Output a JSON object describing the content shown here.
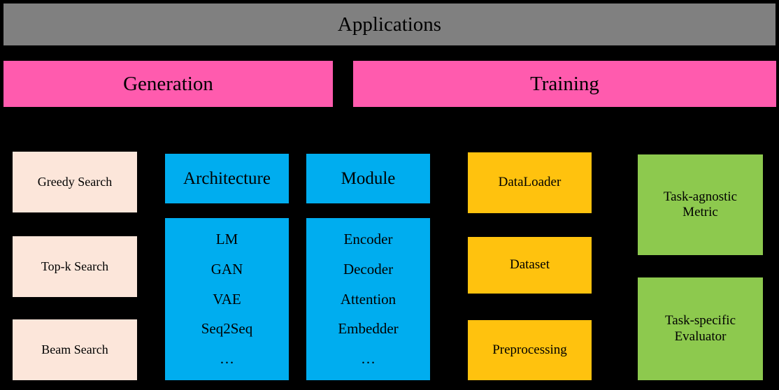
{
  "diagram": {
    "title": "Applications",
    "colors": {
      "background": "#000000",
      "applications_bar": "#808080",
      "category_bar": "#FF5BAE",
      "search_box": "#FCE6DA",
      "model_box": "#00ADEF",
      "data_box": "#FFC20E",
      "eval_box": "#8DC94E"
    },
    "categories": [
      {
        "label": "Generation"
      },
      {
        "label": "Training"
      }
    ],
    "generation": {
      "search_strategies": [
        {
          "label": "Greedy Search"
        },
        {
          "label": "Top-k Search"
        },
        {
          "label": "Beam Search"
        }
      ]
    },
    "model": {
      "architecture": {
        "header": "Architecture",
        "items": [
          "LM",
          "GAN",
          "VAE",
          "Seq2Seq",
          "…"
        ]
      },
      "module": {
        "header": "Module",
        "items": [
          "Encoder",
          "Decoder",
          "Attention",
          "Embedder",
          "…"
        ]
      }
    },
    "training": {
      "data_pipeline": [
        {
          "label": "DataLoader"
        },
        {
          "label": "Dataset"
        },
        {
          "label": "Preprocessing"
        }
      ],
      "evaluation": [
        {
          "label": "Task-agnostic\nMetric"
        },
        {
          "label": "Task-specific\nEvaluator"
        }
      ]
    }
  }
}
